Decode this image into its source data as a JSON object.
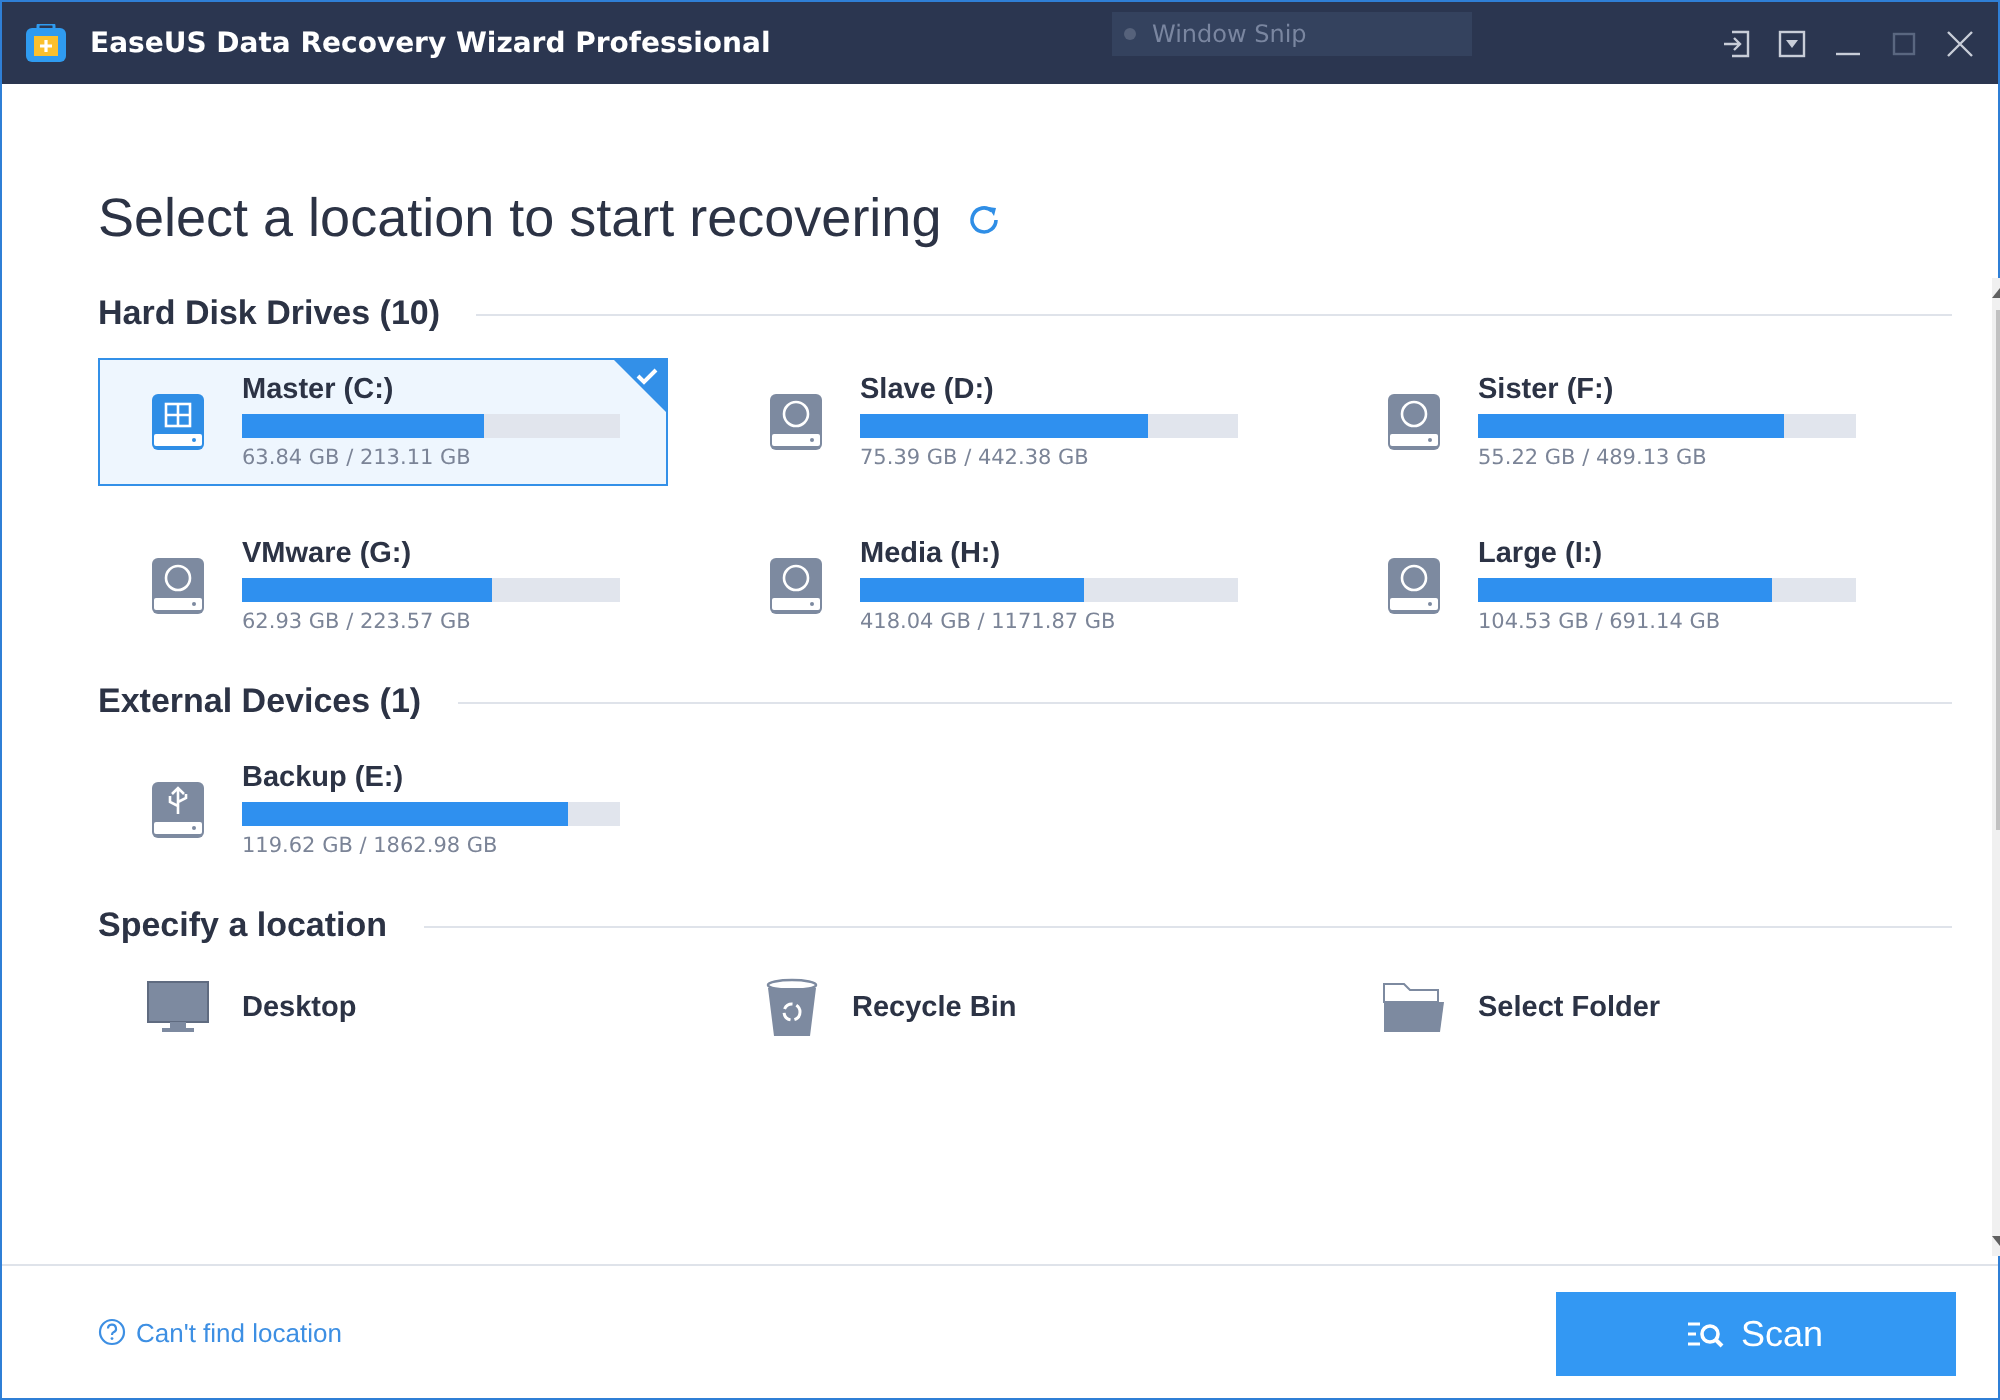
{
  "window": {
    "title": "EaseUS Data Recovery Wizard Professional",
    "overlay_text": "Window Snip"
  },
  "heading": "Select a location to start recovering",
  "sections": [
    {
      "title": "Hard Disk Drives (10)",
      "drives": [
        {
          "name": "Master (C:)",
          "kind": "windows",
          "level": 0.64,
          "usage": "63.84 GB / 213.11 GB",
          "selected": true
        },
        {
          "name": "Slave (D:)",
          "kind": "hdd",
          "level": 0.76,
          "usage": "75.39 GB / 442.38 GB",
          "selected": false
        },
        {
          "name": "Sister (F:)",
          "kind": "hdd",
          "level": 0.81,
          "usage": "55.22 GB / 489.13 GB",
          "selected": false
        },
        {
          "name": "VMware (G:)",
          "kind": "hdd",
          "level": 0.66,
          "usage": "62.93 GB / 223.57 GB",
          "selected": false
        },
        {
          "name": "Media (H:)",
          "kind": "hdd",
          "level": 0.59,
          "usage": "418.04 GB / 1171.87 GB",
          "selected": false
        },
        {
          "name": "Large (I:)",
          "kind": "hdd",
          "level": 0.78,
          "usage": "104.53 GB / 691.14 GB",
          "selected": false
        }
      ]
    },
    {
      "title": "External Devices (1)",
      "drives": [
        {
          "name": "Backup (E:)",
          "kind": "usb",
          "level": 0.86,
          "usage": "119.62 GB / 1862.98 GB",
          "selected": false
        }
      ]
    }
  ],
  "locations_title": "Specify a location",
  "locations": [
    {
      "label": "Desktop",
      "kind": "desktop"
    },
    {
      "label": "Recycle Bin",
      "kind": "recycle"
    },
    {
      "label": "Select Folder",
      "kind": "folder"
    }
  ],
  "footer": {
    "help_link": "Can't find location",
    "scan_button": "Scan"
  }
}
